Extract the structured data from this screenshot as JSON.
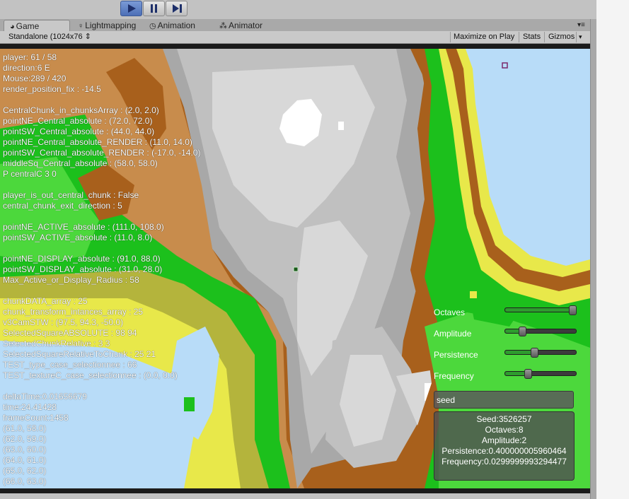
{
  "toolbar": {
    "play": "play-button",
    "pause": "pause-button",
    "step": "step-button"
  },
  "tabs": [
    {
      "label": "Game",
      "icon": "game-icon"
    },
    {
      "label": "Lightmapping",
      "icon": "bulb-icon"
    },
    {
      "label": "Animation",
      "icon": "clock-icon"
    },
    {
      "label": "Animator",
      "icon": "animator-icon"
    }
  ],
  "game_toolbar": {
    "resolution": "Standalone (1024x76",
    "maximize": "Maximize on Play",
    "stats": "Stats",
    "gizmos": "Gizmos"
  },
  "debug": {
    "lines": [
      "player: 61 / 58",
      "direction:6 E",
      "Mouse:289 / 420",
      "render_position_fix : -14.5",
      "",
      "CentralChunk_in_chunksArray : (2.0, 2.0)",
      "pointNE_Central_absolute : (72.0, 72.0)",
      "pointSW_Central_absolute : (44.0, 44.0)",
      "pointNE_Central_absolute_RENDER : (11.0, 14.0)",
      "pointSW_Central_absolute_RENDER : (-17.0, -14.0)",
      "middleSq_Central_absolute : (58.0, 58.0)",
      "P centralC 3 0",
      "",
      "player_is_out_central_chunk : False",
      "central_chunk_exit_direction : 5",
      "",
      "pointNE_ACTIVE_absolute : (111.0, 108.0)",
      "pointSW_ACTIVE_absolute : (11.0, 8.0)",
      "",
      "pointNE_DISPLAY_absolute : (91.0, 88.0)",
      "pointSW_DISPLAY_absolute : (31.0, 28.0)",
      "Max_Active_or_Display_Radius : 58",
      "",
      "chunkDATA_array : 25",
      "chunk_transform_intances_array : 25",
      "v3CamSTW : (97.5, 94.3, -50.0)",
      "SelectedSquareABSOLUTE : 98 94",
      "SelectedChunkRelative : 3 3",
      "SelectedSquareRelativeToChunk : 25 21",
      "TEST_type_case_selectionnee : 66",
      "TEST_textureC_case_selectionnee : (0.0, 0.0)",
      "",
      "deltaTime:0.01656679",
      "time:24.41428",
      "frameCount:1458",
      "(61.0, 58.0)",
      "(62.0, 59.0)",
      "(63.0, 60.0)",
      "(64.0, 61.0)",
      "(65.0, 62.0)",
      "(66.0, 63.0)"
    ]
  },
  "controls": {
    "octaves": {
      "label": "Octaves",
      "value": 0.95
    },
    "amplitude": {
      "label": "Amplitude",
      "value": 0.24
    },
    "persistence": {
      "label": "Persistence",
      "value": 0.41
    },
    "frequency": {
      "label": "Frequency",
      "value": 0.32
    },
    "seed_input": {
      "value": "seed"
    }
  },
  "info": {
    "seed": "Seed:3526257",
    "octaves": "Octaves:8",
    "amplitude": "Amplitude:2",
    "persistence": "Persistence:0.400000005960464",
    "frequency": "Frequency:0.0299999993294477"
  },
  "colors": {
    "water": "#b8dcf8",
    "sand": "#e8e84a",
    "olive": "#b4b43c",
    "green": "#1cc01c",
    "light_green": "#4cd83c",
    "brown": "#a8601c",
    "light_brown": "#c88c4c",
    "dark_gray": "#a8a8a8",
    "gray": "#c0c0c0",
    "light_gray": "#d8d8d8",
    "snow": "#ffffff",
    "accent": "#4c6fb6"
  }
}
